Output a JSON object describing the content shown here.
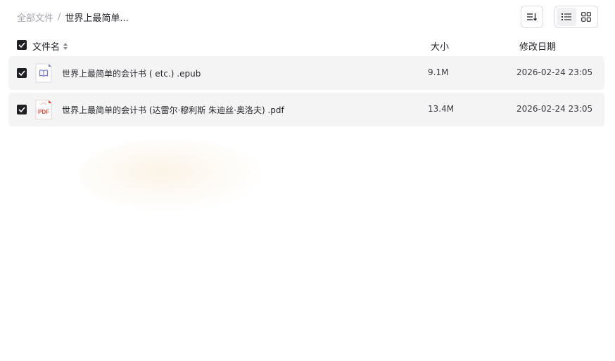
{
  "breadcrumb": {
    "root": "全部文件",
    "separator": "/",
    "current": "世界上最简单..."
  },
  "toolbar": {
    "sort_icon": "sort-descending-icon",
    "list_view_icon": "list-view-icon",
    "grid_view_icon": "grid-view-icon",
    "active_view": "list"
  },
  "table": {
    "columns": {
      "name": "文件名",
      "size": "大小",
      "date": "修改日期"
    },
    "rows": [
      {
        "icon": "epub-file-icon",
        "name": "世界上最简单的会计书 ( etc.) .epub",
        "size": "9.1M",
        "date": "2026-02-24 23:05",
        "checked": true
      },
      {
        "icon": "pdf-file-icon",
        "icon_text": "PDF",
        "name": "世界上最简单的会计书 (达雷尔·穆利斯 朱迪丝·奥洛夫) .pdf",
        "size": "13.4M",
        "date": "2026-02-24 23:05",
        "checked": true
      }
    ]
  },
  "colors": {
    "checkbox": "#1f2024",
    "row_bg": "#f4f4f5",
    "pdf_red": "#e24a3b",
    "epub_purple": "#7b7fe0"
  }
}
